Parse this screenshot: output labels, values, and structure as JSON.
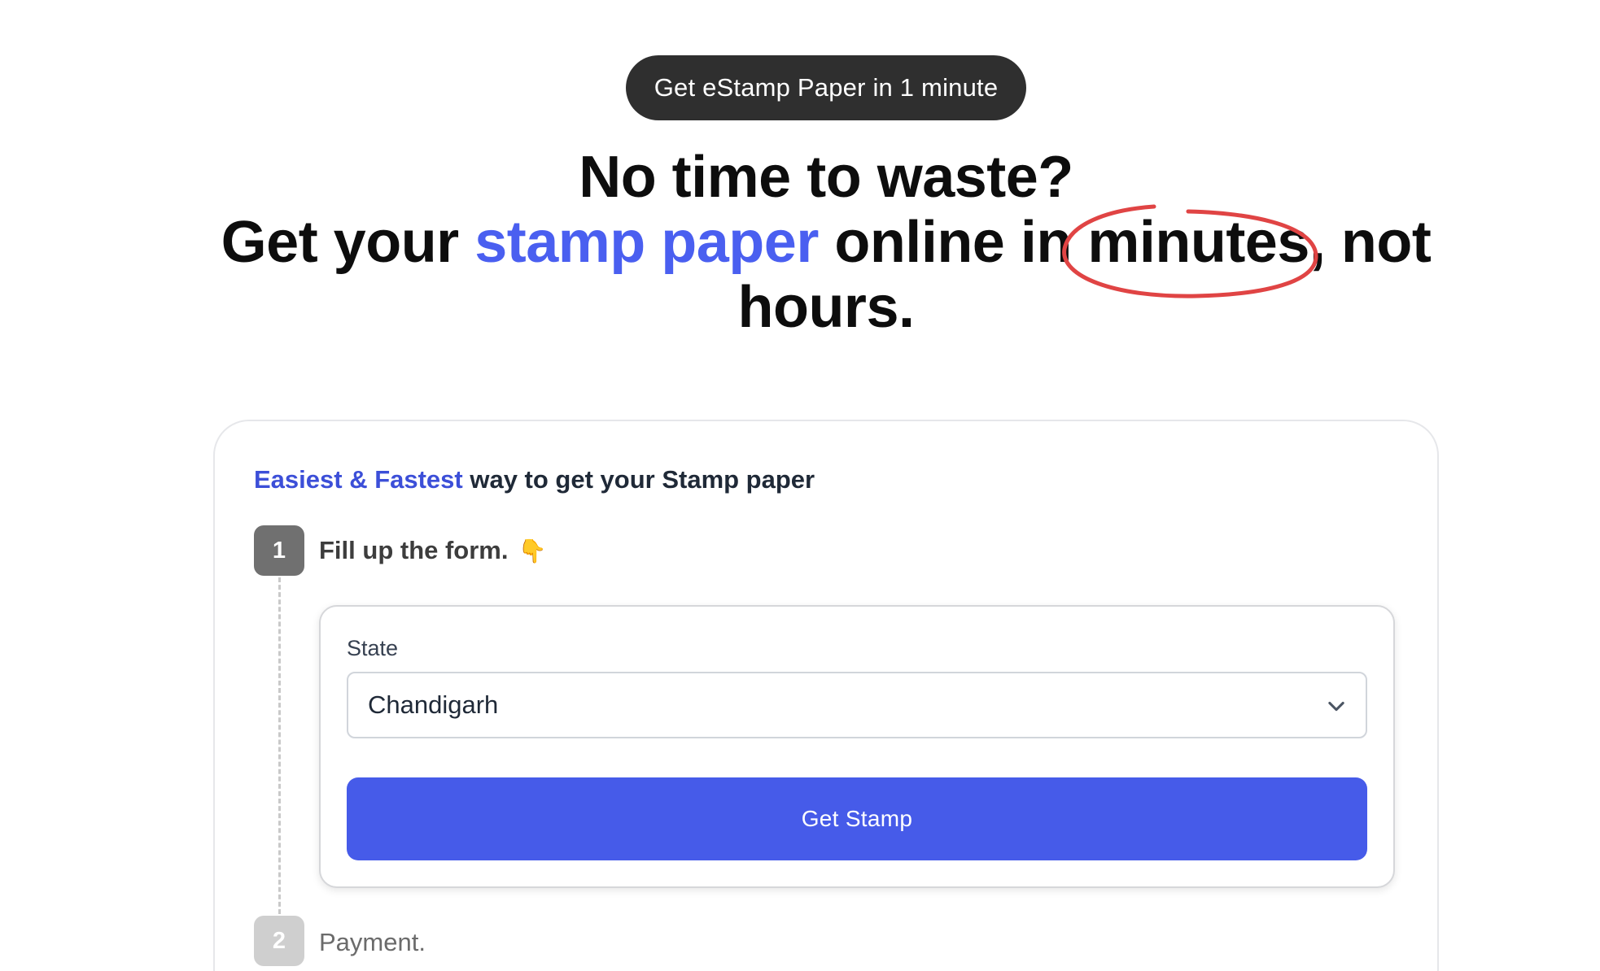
{
  "badge": {
    "text": "Get eStamp Paper in 1 minute"
  },
  "hero": {
    "line1": "No time to waste?",
    "line2_pre": "Get your ",
    "line2_accent": "stamp paper",
    "line2_mid": " online in ",
    "line2_circled": "minutes,",
    "line2_post": " not",
    "line3": "hours."
  },
  "card": {
    "title_highlight": "Easiest & Fastest",
    "title_rest": " way to get your Stamp paper",
    "steps": [
      {
        "number": "1",
        "label": "Fill up the form.",
        "emoji": "👇"
      },
      {
        "number": "2",
        "label": "Payment."
      }
    ],
    "form": {
      "state_label": "State",
      "state_value": "Chandigarh",
      "submit_label": "Get Stamp"
    }
  },
  "colors": {
    "accent": "#4a5ff0",
    "button": "#465be9",
    "badge_bg": "#2f2f2f",
    "circle_stroke": "#e04444"
  },
  "icons": {
    "select_chevron": "chevron-down-icon"
  }
}
